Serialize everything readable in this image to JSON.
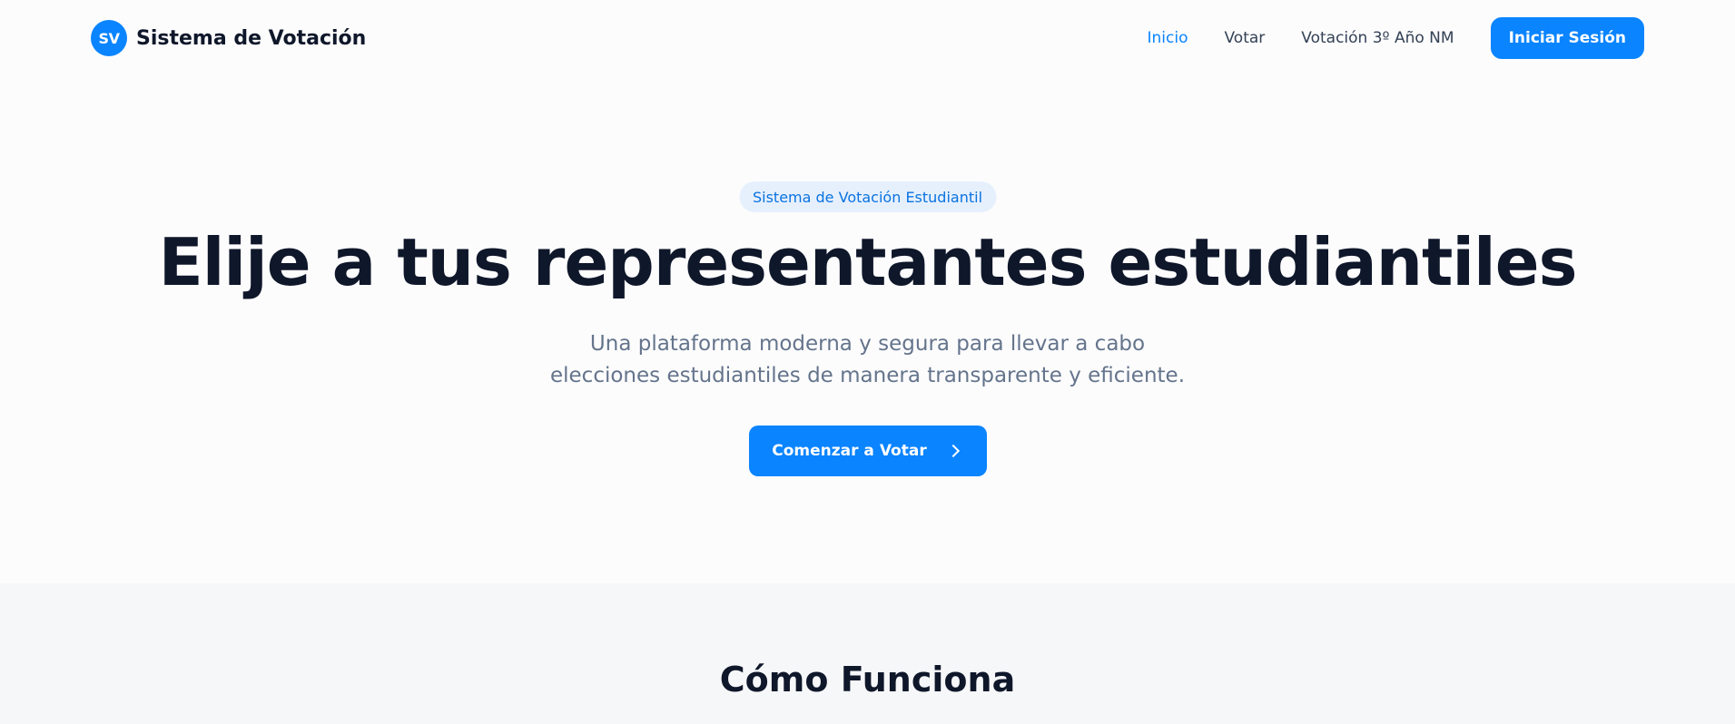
{
  "navbar": {
    "logo_initials": "SV",
    "brand_name": "Sistema de Votación",
    "links": [
      {
        "label": "Inicio",
        "active": true
      },
      {
        "label": "Votar",
        "active": false
      },
      {
        "label": "Votación 3º Año NM",
        "active": false
      }
    ],
    "login_label": "Iniciar Sesión"
  },
  "hero": {
    "badge": "Sistema de Votación Estudiantil",
    "title": "Elije a tus representantes estudiantiles",
    "subtitle": "Una plataforma moderna y segura para llevar a cabo elecciones estudiantiles de manera transparente y eficiente.",
    "cta_label": "Comenzar a Votar",
    "cta_icon": "chevron-right-icon"
  },
  "how_it_works": {
    "title": "Cómo Funciona"
  },
  "colors": {
    "accent": "#0a84ff",
    "badge_bg": "#e6f0fd",
    "text_dark": "#0f172a",
    "text_muted": "#64748b",
    "section_bg": "#f6f7f9"
  }
}
